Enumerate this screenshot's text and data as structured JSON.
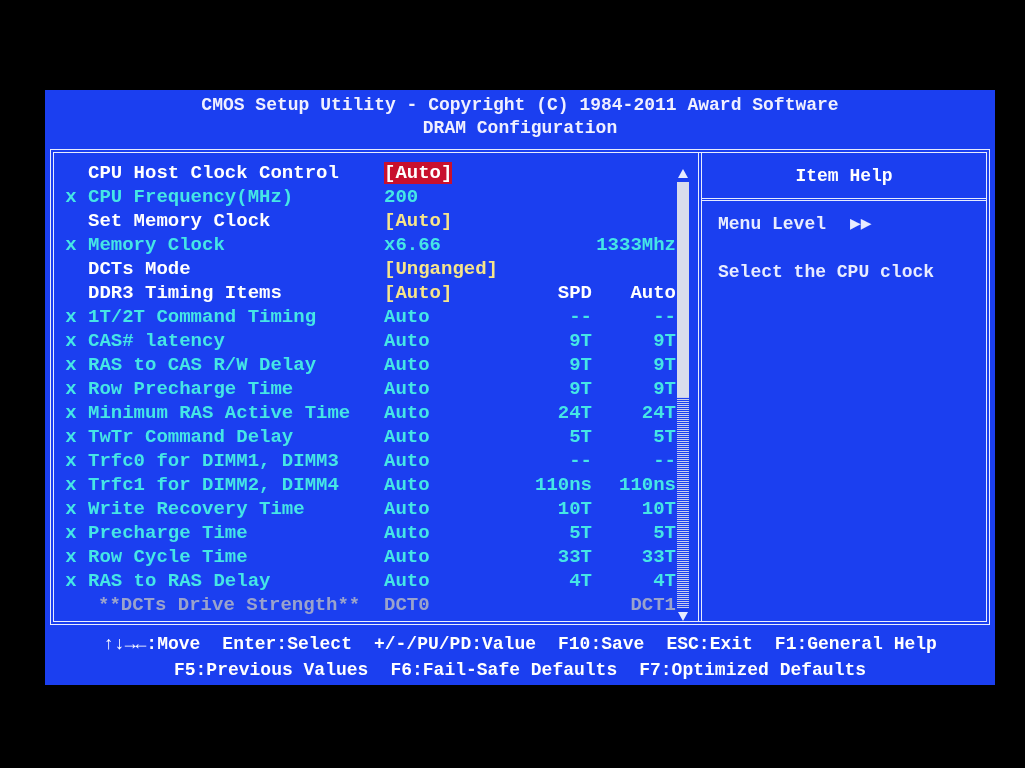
{
  "title": [
    "CMOS Setup Utility - Copyright (C) 1984-2011 Award Software",
    "DRAM Configuration"
  ],
  "rows": [
    {
      "kind": "setting",
      "marker": "",
      "label": "CPU Host Clock Control",
      "value": "[Auto]",
      "spd": "",
      "auto": "",
      "selected": true
    },
    {
      "kind": "info",
      "marker": "x",
      "label": "CPU Frequency(MHz)",
      "value": "200",
      "spd": "",
      "auto": "",
      "selected": false
    },
    {
      "kind": "setting",
      "marker": "",
      "label": "Set Memory Clock",
      "value": "[Auto]",
      "spd": "",
      "auto": "",
      "selected": false
    },
    {
      "kind": "info",
      "marker": "x",
      "label": "Memory Clock",
      "value": "x6.66",
      "spd": "",
      "auto": "1333Mhz",
      "selected": false
    },
    {
      "kind": "setting",
      "marker": "",
      "label": "DCTs Mode",
      "value": "[Unganged]",
      "spd": "",
      "auto": "",
      "selected": false
    },
    {
      "kind": "setting",
      "marker": "",
      "label": "DDR3 Timing Items",
      "value": "[Auto]",
      "spd": "SPD",
      "auto": "Auto",
      "selected": false
    },
    {
      "kind": "info",
      "marker": "x",
      "label": "1T/2T Command Timing",
      "value": "Auto",
      "spd": "--",
      "auto": "--",
      "selected": false
    },
    {
      "kind": "info",
      "marker": "x",
      "label": "CAS# latency",
      "value": "Auto",
      "spd": "9T",
      "auto": "9T",
      "selected": false
    },
    {
      "kind": "info",
      "marker": "x",
      "label": "RAS to CAS R/W Delay",
      "value": "Auto",
      "spd": "9T",
      "auto": "9T",
      "selected": false
    },
    {
      "kind": "info",
      "marker": "x",
      "label": "Row Precharge Time",
      "value": "Auto",
      "spd": "9T",
      "auto": "9T",
      "selected": false
    },
    {
      "kind": "info",
      "marker": "x",
      "label": "Minimum RAS Active Time",
      "value": "Auto",
      "spd": "24T",
      "auto": "24T",
      "selected": false
    },
    {
      "kind": "info",
      "marker": "x",
      "label": "TwTr Command Delay",
      "value": "Auto",
      "spd": "5T",
      "auto": "5T",
      "selected": false
    },
    {
      "kind": "info",
      "marker": "x",
      "label": "Trfc0 for DIMM1, DIMM3",
      "value": "Auto",
      "spd": "--",
      "auto": "--",
      "selected": false
    },
    {
      "kind": "info",
      "marker": "x",
      "label": "Trfc1 for DIMM2, DIMM4",
      "value": "Auto",
      "spd": "110ns",
      "auto": "110ns",
      "selected": false
    },
    {
      "kind": "info",
      "marker": "x",
      "label": "Write Recovery Time",
      "value": "Auto",
      "spd": "10T",
      "auto": "10T",
      "selected": false
    },
    {
      "kind": "info",
      "marker": "x",
      "label": "Precharge Time",
      "value": "Auto",
      "spd": "5T",
      "auto": "5T",
      "selected": false
    },
    {
      "kind": "info",
      "marker": "x",
      "label": "Row Cycle Time",
      "value": "Auto",
      "spd": "33T",
      "auto": "33T",
      "selected": false
    },
    {
      "kind": "info",
      "marker": "x",
      "label": "RAS to RAS Delay",
      "value": "Auto",
      "spd": "4T",
      "auto": "4T",
      "selected": false
    },
    {
      "kind": "header",
      "marker": "",
      "label": "**DCTs Drive Strength**",
      "value": "DCT0",
      "spd": "",
      "auto": "DCT1",
      "selected": false
    }
  ],
  "item_help": {
    "title": "Item Help",
    "menu_level_label": "Menu Level",
    "menu_level_arrows": "▶▶",
    "text": "Select the CPU clock"
  },
  "footer": [
    [
      "↑↓→←:Move",
      "Enter:Select",
      "+/-/PU/PD:Value",
      "F10:Save",
      "ESC:Exit",
      "F1:General Help"
    ],
    [
      "F5:Previous Values",
      "F6:Fail-Safe Defaults",
      "F7:Optimized Defaults"
    ]
  ]
}
